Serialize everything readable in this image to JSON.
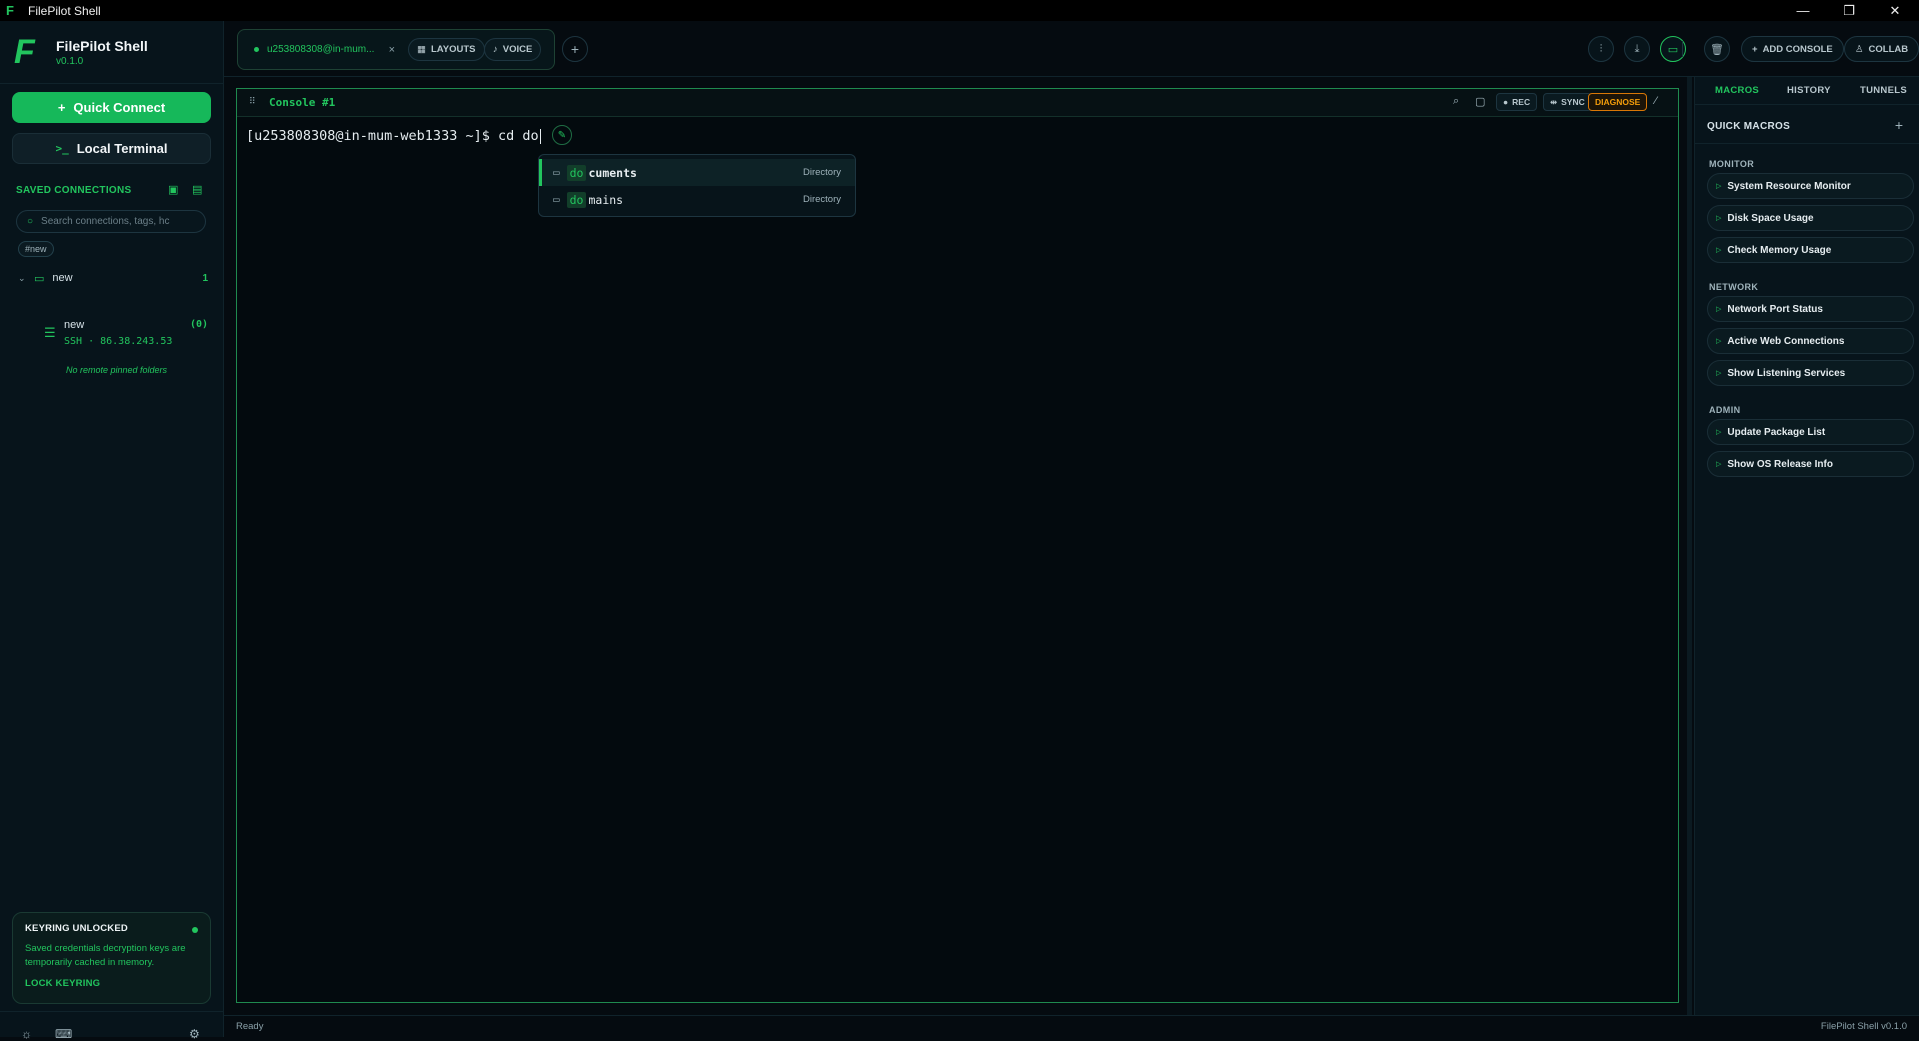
{
  "window": {
    "title": "FilePilot Shell",
    "minimize": "—",
    "maximize": "❐",
    "close": "✕"
  },
  "sidebar": {
    "brand_name": "FilePilot Shell",
    "version": "v0.1.0",
    "quick_connect": "Quick Connect",
    "local_terminal": "Local Terminal",
    "saved_connections": "SAVED CONNECTIONS",
    "search_placeholder": "Search connections, tags, hc",
    "tag": "#new",
    "folder": {
      "name": "new",
      "count": "1"
    },
    "connection": {
      "name": "new",
      "address": "SSH · 86.38.243.53",
      "count": "(0)"
    },
    "no_pinned": "No remote pinned folders",
    "keyring": {
      "title": "KEYRING UNLOCKED",
      "text": "Saved credentials decryption keys are temporarily cached in memory.",
      "lock": "LOCK KEYRING"
    }
  },
  "topbar": {
    "session_tab": "u253808308@in-mum...",
    "layouts": "LAYOUTS",
    "voice": "VOICE",
    "add_console": "ADD CONSOLE",
    "collab": "COLLAB"
  },
  "console": {
    "title": "Console #1",
    "rec": "REC",
    "sync": "SYNC",
    "diagnose": "DIAGNOSE",
    "prompt": "[u253808308@in-mum-web1333 ~]$ cd do",
    "suggestions": [
      {
        "match": "do",
        "rest": "cuments",
        "type": "Directory"
      },
      {
        "match": "do",
        "rest": "mains",
        "type": "Directory"
      }
    ]
  },
  "status": {
    "text": "Ready",
    "version": "FilePilot Shell v0.1.0"
  },
  "rightpanel": {
    "tabs": [
      "MACROS",
      "HISTORY",
      "TUNNELS"
    ],
    "quick_macros": "QUICK MACROS",
    "categories": [
      {
        "name": "MONITOR",
        "items": [
          "System Resource Monitor",
          "Disk Space Usage",
          "Check Memory Usage"
        ]
      },
      {
        "name": "NETWORK",
        "items": [
          "Network Port Status",
          "Active Web Connections",
          "Show Listening Services"
        ]
      },
      {
        "name": "ADMIN",
        "items": [
          "Update Package List",
          "Show OS Release Info"
        ]
      }
    ]
  }
}
